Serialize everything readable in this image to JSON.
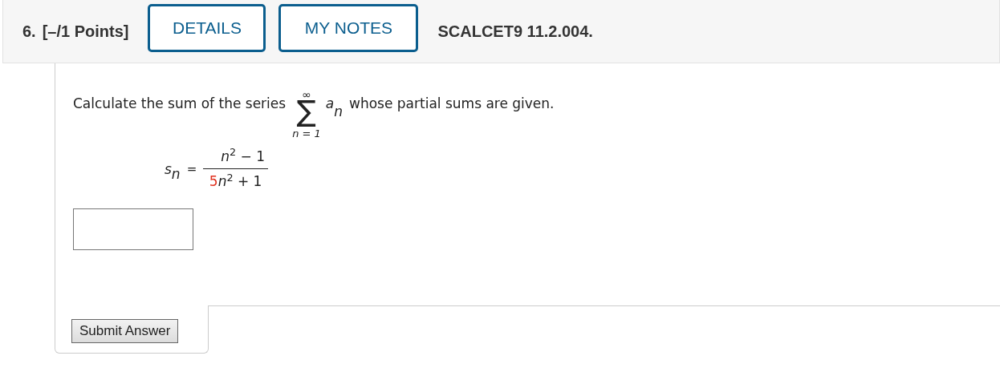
{
  "header": {
    "number": "6.",
    "points": "[–/1 Points]",
    "buttons": [
      {
        "label": "DETAILS"
      },
      {
        "label": "MY NOTES"
      }
    ],
    "code": "SCALCET9 11.2.004."
  },
  "question": {
    "text_before": "Calculate the sum of the series",
    "sum": {
      "upper": "∞",
      "symbol": "∑",
      "lower": "n = 1"
    },
    "term": "a",
    "term_subscript": "n",
    "text_after": "whose partial sums are given."
  },
  "formula": {
    "lhs": "s",
    "lhs_subscript": "n",
    "equals": "=",
    "numerator": "*n*$^{2}$ − 1",
    "denominator": [
      {
        "text": "5",
        "highlighted": true
      },
      {
        "text": "*n*$^{2}$ + 1",
        "highlighted": false
      }
    ]
  },
  "submit_button": "Submit Answer"
}
